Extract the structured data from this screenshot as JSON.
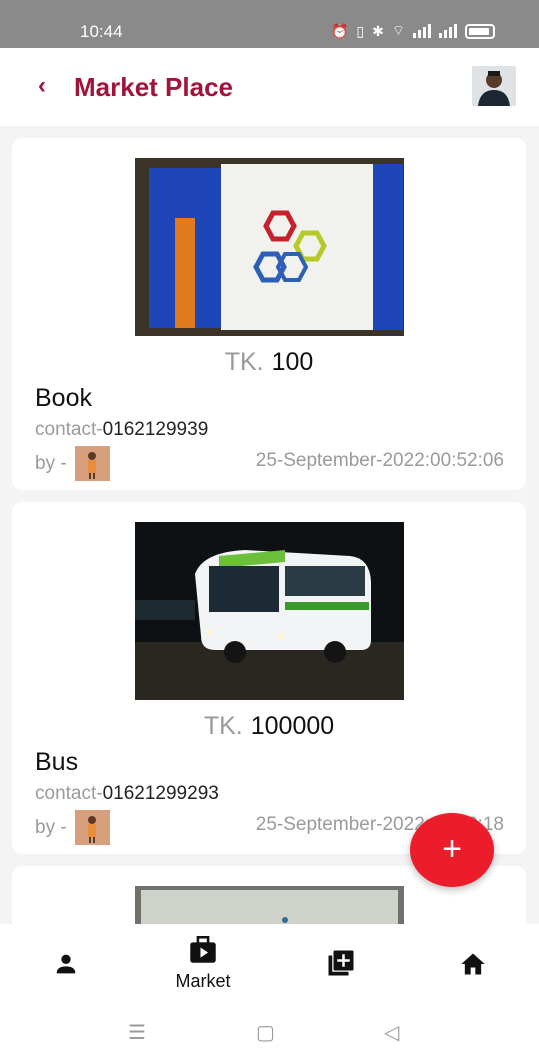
{
  "status_bar": {
    "time": "10:44"
  },
  "app_bar": {
    "back_icon": "chevron-left-icon",
    "title": "Market Place"
  },
  "listings": [
    {
      "price_currency": "TK.",
      "price": "100",
      "name": "Book",
      "contact_label": "contact-",
      "contact": "0162129939",
      "by_label": "by -",
      "date": "25-September-2022:00:52:06"
    },
    {
      "price_currency": "TK.",
      "price": "100000",
      "name": "Bus",
      "contact_label": "contact-",
      "contact": "01621299293",
      "by_label": "by -",
      "date": "25-September-2022:00:52:18"
    }
  ],
  "fab": {
    "label": "+"
  },
  "bottom_nav": {
    "items": [
      {
        "icon": "person-icon",
        "label": ""
      },
      {
        "icon": "briefcase-play-icon",
        "label": "Market"
      },
      {
        "icon": "add-library-icon",
        "label": ""
      },
      {
        "icon": "home-icon",
        "label": ""
      }
    ]
  },
  "colors": {
    "accent": "#a0143c",
    "fab": "#ec1c2a",
    "status_bar": "#8a8a8a"
  }
}
